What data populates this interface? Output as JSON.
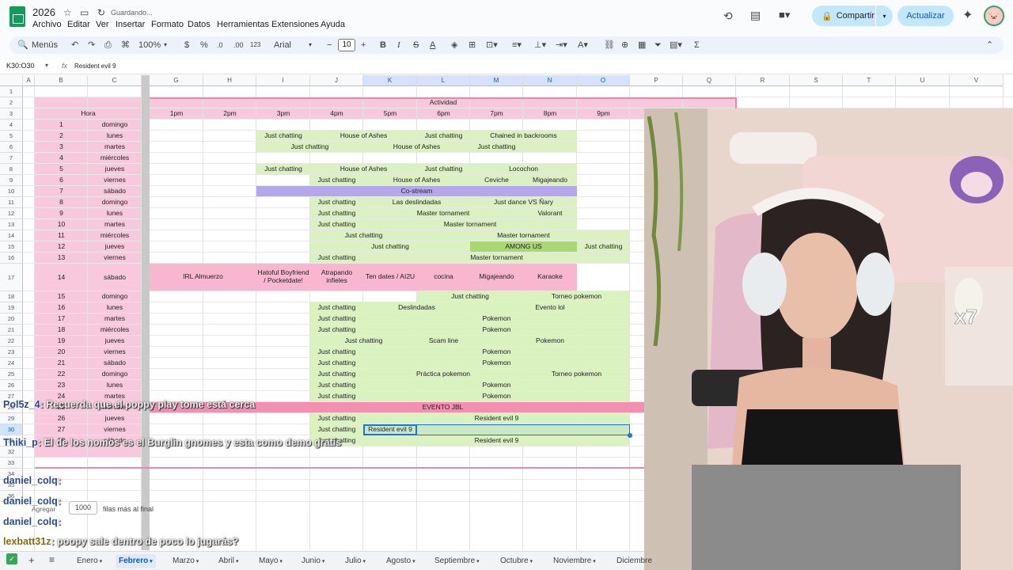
{
  "title_bar": {
    "doc_title": "2026",
    "saving": "Guardando...",
    "menus": [
      "Archivo",
      "Editar",
      "Ver",
      "Insertar",
      "Formato",
      "Datos",
      "Herramientas",
      "Extensiones",
      "Ayuda"
    ],
    "share": "Compartir",
    "update": "Actualizar"
  },
  "toolbar": {
    "search": "Menús",
    "zoom": "100%",
    "currency": "$",
    "percent": "%",
    "dec_less": ".0",
    "dec_more": ".00",
    "num_format": "123",
    "font": "Arial",
    "font_size": "10"
  },
  "formula_bar": {
    "name_box": "K30:O30",
    "content": "Resident evil 9"
  },
  "columns": [
    "A",
    "B",
    "C",
    "G",
    "H",
    "I",
    "J",
    "K",
    "L",
    "M",
    "N",
    "O",
    "P",
    "Q",
    "R",
    "S",
    "T",
    "U",
    "V"
  ],
  "rows": [
    "1",
    "2",
    "3",
    "4",
    "5",
    "6",
    "7",
    "8",
    "9",
    "10",
    "11",
    "12",
    "13",
    "14",
    "15",
    "16",
    "17",
    "18",
    "19",
    "20",
    "21",
    "22",
    "23",
    "24",
    "25",
    "26",
    "27",
    "28",
    "29",
    "30",
    "31",
    "32",
    "33",
    "34",
    "35",
    "36"
  ],
  "sheet": {
    "header_actividad": "Actividad",
    "header_hora": "Hora",
    "hours": [
      "1pm",
      "2pm",
      "3pm",
      "4pm",
      "5pm",
      "6pm",
      "7pm",
      "8pm",
      "9pm"
    ],
    "days": [
      {
        "n": "1",
        "d": "domingo"
      },
      {
        "n": "2",
        "d": "lunes"
      },
      {
        "n": "3",
        "d": "martes"
      },
      {
        "n": "4",
        "d": "miércoles"
      },
      {
        "n": "5",
        "d": "jueves"
      },
      {
        "n": "6",
        "d": "viernes"
      },
      {
        "n": "7",
        "d": "sábado"
      },
      {
        "n": "8",
        "d": "domingo"
      },
      {
        "n": "9",
        "d": "lunes"
      },
      {
        "n": "10",
        "d": "martes"
      },
      {
        "n": "11",
        "d": "miércoles"
      },
      {
        "n": "12",
        "d": "jueves"
      },
      {
        "n": "13",
        "d": "viernes"
      },
      {
        "n": "14",
        "d": "sábado"
      },
      {
        "n": "15",
        "d": "domingo"
      },
      {
        "n": "16",
        "d": "lunes"
      },
      {
        "n": "17",
        "d": "martes"
      },
      {
        "n": "18",
        "d": "miércoles"
      },
      {
        "n": "19",
        "d": "jueves"
      },
      {
        "n": "20",
        "d": "viernes"
      },
      {
        "n": "21",
        "d": "sábado"
      },
      {
        "n": "22",
        "d": "domingo"
      },
      {
        "n": "23",
        "d": "lunes"
      },
      {
        "n": "24",
        "d": "martes"
      },
      {
        "n": "25",
        "d": "miércoles"
      },
      {
        "n": "26",
        "d": "jueves"
      },
      {
        "n": "27",
        "d": "viernes"
      },
      {
        "n": "28",
        "d": "sábado"
      }
    ],
    "events": [
      [
        "Just chatting",
        "House of Ashes",
        "Just chatting",
        "Chained in backrooms"
      ],
      [
        "Just chatting",
        "House of Ashes",
        "Just chatting"
      ],
      [
        "Just chatting",
        "House of Ashes",
        "Just chatting",
        "Locochon"
      ],
      [
        "Just chatting",
        "House of Ashes",
        "Ceviche",
        "Migajeando"
      ],
      [
        "Co-stream"
      ],
      [
        "Just chatting",
        "Las deslindadas",
        "Just dance VS Ñary"
      ],
      [
        "Just chatting",
        "Master tornament",
        "Valorant"
      ],
      [
        "Just chatting",
        "Master tornament"
      ],
      [
        "Just chatting",
        "Master tornament"
      ],
      [
        "Just chatting",
        "AMONG US",
        "Just chatting"
      ],
      [
        "Just chatting",
        "Master tornament"
      ],
      [
        "IRL Almuerzo",
        "Hatoful Boyfriend / Pocketdate!",
        "Atrapando infieles",
        "Ten dates / AI2U",
        "cocina",
        "Migajeando",
        "Karaoke"
      ],
      [
        "Just chatting",
        "Torneo pokemon"
      ],
      [
        "Just chatting",
        "Deslindadas",
        "Evento lol"
      ],
      [
        "Just chatting",
        "Pokemon"
      ],
      [
        "Just chatting",
        "Pokemon"
      ],
      [
        "Just chatting",
        "Scam line",
        "Pokemon"
      ],
      [
        "Just chatting",
        "Pokemon"
      ],
      [
        "Just chatting",
        "Pokemon"
      ],
      [
        "Just chatting",
        "Práctica pokemon",
        "Torneo pokemon"
      ],
      [
        "Just chatting",
        "Pokemon"
      ],
      [
        "Just chatting",
        "Pokemon"
      ],
      [
        "EVENTO JBL"
      ],
      [
        "Just chatting",
        "Resident evil 9"
      ],
      [
        "Just chatting",
        "Resident evil 9"
      ],
      [
        "Just chatting",
        "Resident evil 9"
      ]
    ]
  },
  "add_rows": {
    "label": "Agregar",
    "count": "1000",
    "suffix": "filas más al final"
  },
  "chat": [
    {
      "user": "Pol5z_4",
      "msg": ": Recuerda que el poppy play tome está cerca"
    },
    {
      "user": "Thiki_p",
      "msg": ": El de los nomos es el Burglin gnomes y esta como demo gratis"
    },
    {
      "user": "daniel_colq",
      "msg": ":"
    },
    {
      "user": "daniel_colq",
      "msg": ":"
    },
    {
      "user": "daniel_colq",
      "msg": ":"
    },
    {
      "user": "lexbatt31z",
      "msg": ": poopy sale dentro de poco lo jugarás?"
    }
  ],
  "sheet_tabs": [
    "Enero",
    "Febrero",
    "Marzo",
    "Abril",
    "Mayo",
    "Junio",
    "Julio",
    "Agosto",
    "Septiembre",
    "Octubre",
    "Noviembre",
    "Diciembre"
  ],
  "colors": {
    "pink": "#f8c8dc",
    "green": "#d9f2c0",
    "purple": "#b4a7f0",
    "hotpink": "#f48fb1",
    "accent": "#0b57d0"
  }
}
